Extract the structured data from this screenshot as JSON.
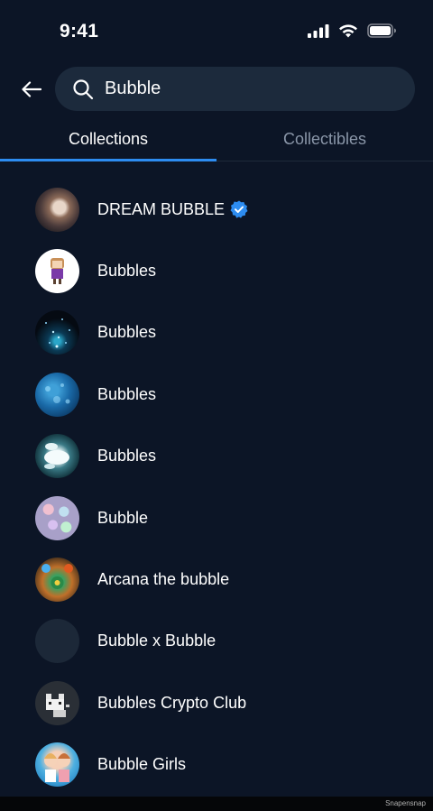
{
  "status_bar": {
    "time": "9:41"
  },
  "search": {
    "value": "Bubble"
  },
  "tabs": [
    {
      "label": "Collections",
      "active": true
    },
    {
      "label": "Collectibles",
      "active": false
    }
  ],
  "collections": [
    {
      "name": "DREAM BUBBLE",
      "verified": true
    },
    {
      "name": "Bubbles"
    },
    {
      "name": "Bubbles"
    },
    {
      "name": "Bubbles"
    },
    {
      "name": "Bubbles"
    },
    {
      "name": "Bubble"
    },
    {
      "name": "Arcana the bubble"
    },
    {
      "name": "Bubble x Bubble"
    },
    {
      "name": "Bubbles Crypto Club"
    },
    {
      "name": "Bubble Girls"
    }
  ],
  "watermark": "Snapensnap",
  "colors": {
    "accent": "#2d8cf0",
    "background": "#0c1526",
    "search_bg": "#1c2a3c",
    "inactive_tab": "#8a96a8"
  }
}
